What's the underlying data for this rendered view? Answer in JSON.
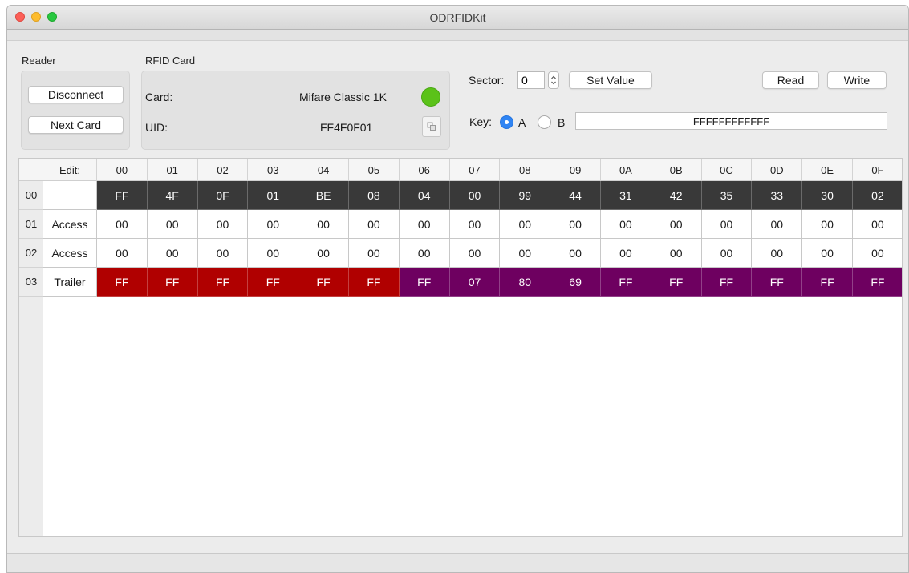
{
  "window": {
    "title": "ODRFIDKit"
  },
  "reader": {
    "label": "Reader",
    "disconnect_label": "Disconnect",
    "next_card_label": "Next Card"
  },
  "rfid_card": {
    "label": "RFID Card",
    "card_label": "Card:",
    "card_value": "Mifare Classic 1K",
    "uid_label": "UID:",
    "uid_value": "FF4F0F01",
    "status_color": "#5bc219",
    "copy_icon": "copy-icon"
  },
  "sector": {
    "label": "Sector:",
    "value": "0",
    "set_value_label": "Set Value"
  },
  "actions": {
    "read_label": "Read",
    "write_label": "Write"
  },
  "key": {
    "label": "Key:",
    "option_a": "A",
    "option_b": "B",
    "selected": "A",
    "value": "FFFFFFFFFFFF"
  },
  "colors": {
    "manufacturer_row": "#393939",
    "key_bytes": "#b00000",
    "access_bits": "#6e0060"
  },
  "table": {
    "edit_header": "Edit:",
    "columns": [
      "00",
      "01",
      "02",
      "03",
      "04",
      "05",
      "06",
      "07",
      "08",
      "09",
      "0A",
      "0B",
      "0C",
      "0D",
      "0E",
      "0F"
    ],
    "rows": [
      {
        "index": "00",
        "label": "",
        "style": "manufacturer",
        "cells": [
          "FF",
          "4F",
          "0F",
          "01",
          "BE",
          "08",
          "04",
          "00",
          "99",
          "44",
          "31",
          "42",
          "35",
          "33",
          "30",
          "02"
        ]
      },
      {
        "index": "01",
        "label": "Access",
        "style": "plain",
        "cells": [
          "00",
          "00",
          "00",
          "00",
          "00",
          "00",
          "00",
          "00",
          "00",
          "00",
          "00",
          "00",
          "00",
          "00",
          "00",
          "00"
        ]
      },
      {
        "index": "02",
        "label": "Access",
        "style": "plain",
        "cells": [
          "00",
          "00",
          "00",
          "00",
          "00",
          "00",
          "00",
          "00",
          "00",
          "00",
          "00",
          "00",
          "00",
          "00",
          "00",
          "00"
        ]
      },
      {
        "index": "03",
        "label": "Trailer",
        "style": "trailer",
        "cells": [
          "FF",
          "FF",
          "FF",
          "FF",
          "FF",
          "FF",
          "FF",
          "07",
          "80",
          "69",
          "FF",
          "FF",
          "FF",
          "FF",
          "FF",
          "FF"
        ]
      }
    ]
  }
}
